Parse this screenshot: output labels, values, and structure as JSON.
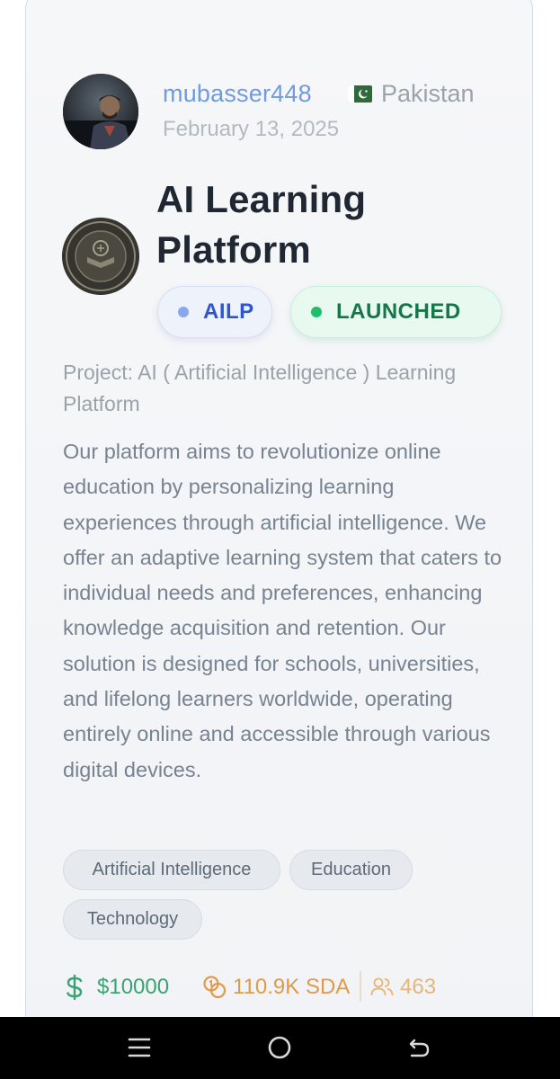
{
  "user": {
    "username": "mubasser448",
    "country": "Pakistan",
    "date": "February 13, 2025"
  },
  "project": {
    "title": "AI Learning Platform",
    "ticker": "AILP",
    "status": "LAUNCHED",
    "subtitle": "Project: AI ( Artificial Intelligence ) Learning Platform",
    "description": "Our platform aims to revolutionize online education by personalizing learning experiences through artificial intelligence. We offer an adaptive learning system that caters to individual needs and preferences, enhancing knowledge acquisition and retention. Our solution is designed for schools, universities, and lifelong learners worldwide, operating entirely online and accessible through various digital devices.",
    "tags": [
      "Artificial Intelligence",
      "Education",
      "Technology"
    ]
  },
  "stats": {
    "funding": "$10000",
    "sda": "110.9K SDA",
    "members": "463"
  },
  "icons": {
    "flag": "pakistan-flag-icon",
    "funding": "dollar-icon",
    "sda": "coins-icon",
    "members": "users-icon",
    "nav_menu": "menu-icon",
    "nav_home": "home-circle-icon",
    "nav_back": "back-icon"
  },
  "colors": {
    "username": "#6f9be0",
    "ticker": "#2f56d0",
    "status": "#16764a",
    "funding": "#3aa374",
    "sda": "#df9a4a",
    "members": "#e8b47a"
  }
}
